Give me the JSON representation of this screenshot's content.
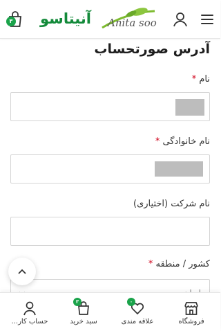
{
  "header": {
    "logo_text": "آنیتاسو",
    "logo_mark_text": "Anita soo",
    "cart_count": "۳"
  },
  "form": {
    "section_title": "آدرس صورتحساب",
    "first_name_label": "نام",
    "last_name_label": "نام خانوادگی",
    "company_label": "نام شرکت (اختیاری)",
    "country_label": "کشور / منطقه",
    "required_mark": "*",
    "country_value": "ایران"
  },
  "bottom_nav": {
    "items": [
      {
        "label": "فروشگاه",
        "icon": "store-icon"
      },
      {
        "label": "علاقه مندی",
        "icon": "heart-icon",
        "badge": "۰"
      },
      {
        "label": "سبد خرید",
        "icon": "cart-icon",
        "badge": "۳"
      },
      {
        "label": "حساب کار...",
        "icon": "user-icon"
      }
    ]
  },
  "colors": {
    "brand_green": "#138a3a",
    "badge_green": "#1aa34a",
    "required_red": "#d0021b"
  }
}
